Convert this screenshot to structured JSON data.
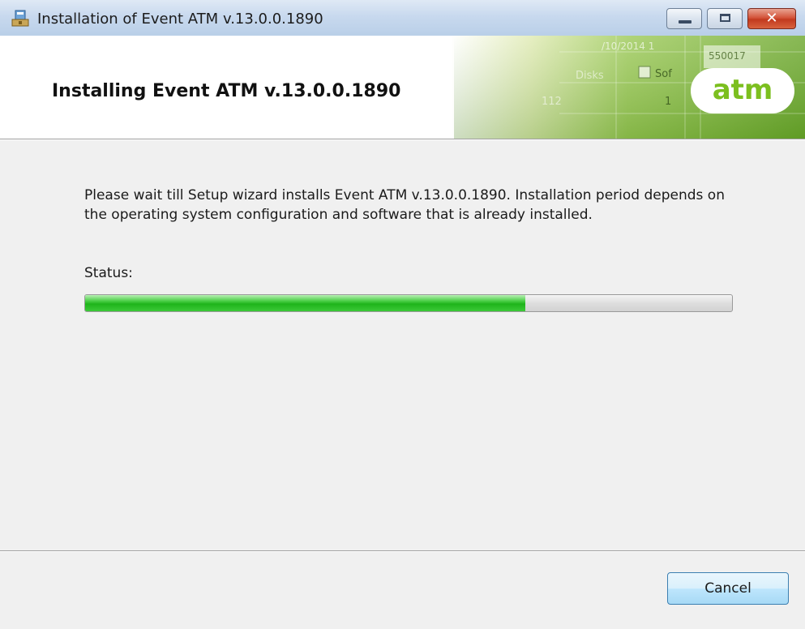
{
  "window": {
    "title": "Installation of Event ATM v.13.0.0.1890",
    "icon": "installer-icon",
    "controls": [
      "minimize-icon",
      "maximize-icon",
      "close-icon"
    ]
  },
  "header": {
    "title": "Installing Event ATM v.13.0.0.1890",
    "logo_text": "atm",
    "background_texts": [
      "/10/2014 1",
      "550017",
      "Disks",
      "Sof",
      "112",
      "1"
    ],
    "accent_color": "#7cbf1f"
  },
  "main": {
    "description": "Please wait till Setup wizard installs Event ATM v.13.0.0.1890. Installation period depends on the operating system configuration and software that is already installed.",
    "status_label": "Status:",
    "progress_fraction": 0.68
  },
  "footer": {
    "cancel_label": "Cancel"
  }
}
